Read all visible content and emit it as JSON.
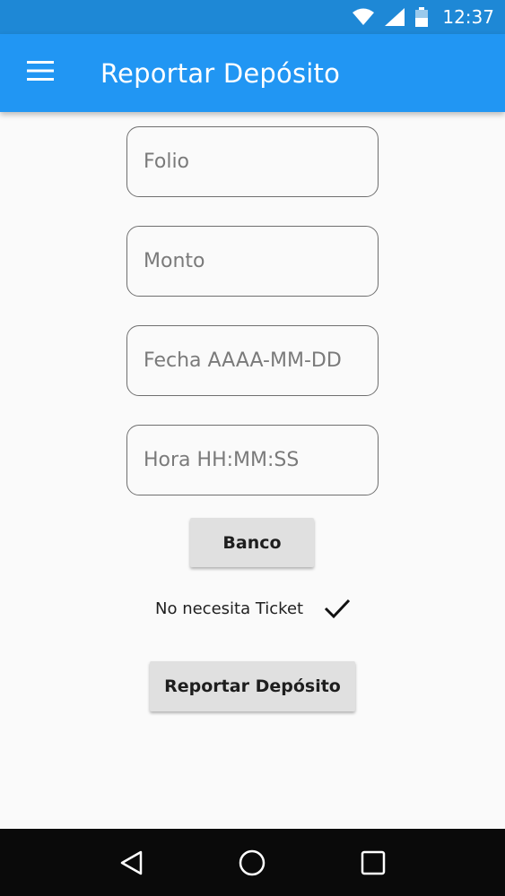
{
  "status_bar": {
    "time": "12:37",
    "icons": [
      "wifi-icon",
      "signal-icon",
      "battery-icon"
    ]
  },
  "app_bar": {
    "title": "Reportar Depósito",
    "menu_icon": "hamburger-menu-icon",
    "color": "#2196f3"
  },
  "form": {
    "folio": {
      "value": "",
      "placeholder": "Folio"
    },
    "monto": {
      "value": "",
      "placeholder": "Monto"
    },
    "fecha": {
      "value": "",
      "placeholder": "Fecha AAAA-MM-DD"
    },
    "hora": {
      "value": "",
      "placeholder": "Hora HH:MM:SS"
    },
    "banco_label": "Banco",
    "ticket_label": "No necesita Ticket",
    "ticket_checked": true,
    "submit_label": "Reportar Depósito"
  },
  "nav_bar": {
    "icons": [
      "back-icon",
      "home-icon",
      "recents-icon"
    ]
  }
}
